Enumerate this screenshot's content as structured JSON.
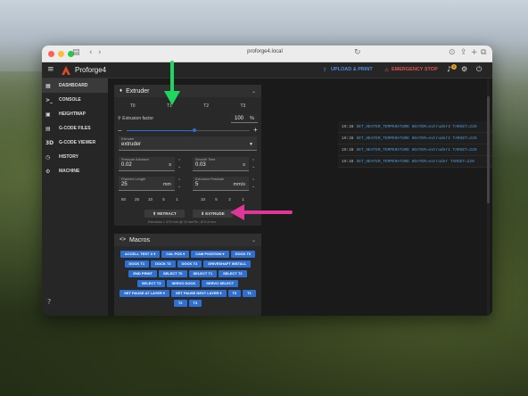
{
  "browser": {
    "url": "proforge4.local"
  },
  "app": {
    "title": "Proforge4",
    "upload_label": "UPLOAD & PRINT",
    "estop_label": "EMERGENCY STOP",
    "badge_count": "1",
    "accent": "#2f6fd0",
    "danger": "#e05050"
  },
  "sidebar": {
    "items": [
      {
        "label": "DASHBOARD",
        "icon": "dashboard-icon"
      },
      {
        "label": "CONSOLE",
        "icon": "console-icon"
      },
      {
        "label": "HEIGHTMAP",
        "icon": "heightmap-icon"
      },
      {
        "label": "G-CODE FILES",
        "icon": "files-icon"
      },
      {
        "label": "G-CODE VIEWER",
        "icon": "3d-icon"
      },
      {
        "label": "HISTORY",
        "icon": "history-icon"
      },
      {
        "label": "MACHINE",
        "icon": "machine-icon"
      }
    ]
  },
  "extruder": {
    "title": "Extruder",
    "tabs": [
      "T0",
      "T1",
      "T2",
      "T3"
    ],
    "factor_label": "Extrusion factor",
    "factor_value": "100",
    "factor_unit": "%",
    "factor_fraction": 0.55,
    "select_label": "Extruder",
    "select_value": "extruder",
    "pa_label": "Pressure Advance",
    "pa_value": "0.02",
    "pa_unit": "s",
    "st_label": "Smooth Time",
    "st_value": "0.03",
    "st_unit": "s",
    "len_label": "Filament Length",
    "len_value": "25",
    "len_unit": "mm",
    "feed_label": "Extrusion Feedrate",
    "feed_value": "5",
    "feed_unit": "mm/s",
    "len_steps": [
      "50",
      "25",
      "10",
      "5",
      "1"
    ],
    "feed_steps": [
      "10",
      "5",
      "2",
      "1"
    ],
    "retract_label": "RETRACT",
    "extrude_label": "EXTRUDE",
    "info": "Extrusion = 479 mm @ 12 mm³/s - Ø 0.4 mm"
  },
  "macros": {
    "title": "Macros",
    "buttons": [
      {
        "label": "ACCELL TEST X",
        "dropdown": true
      },
      {
        "label": "CAL POS",
        "dropdown": true
      },
      {
        "label": "CAM POSITION",
        "dropdown": true
      },
      {
        "label": "DOCK T0"
      },
      {
        "label": "DOCK T1"
      },
      {
        "label": "DOCK T2"
      },
      {
        "label": "DOCK T3"
      },
      {
        "label": "DRIVESHAFT INSTALL"
      },
      {
        "label": "END PRINT"
      },
      {
        "label": "SELECT T0"
      },
      {
        "label": "SELECT T1"
      },
      {
        "label": "SELECT T2"
      },
      {
        "label": "SELECT T3"
      },
      {
        "label": "SERVO DOCK"
      },
      {
        "label": "SERVO SELECT"
      },
      {
        "label": "SET PAUSE AT LAYER",
        "dropdown": true
      },
      {
        "label": "SET PAUSE NEXT LAYER",
        "dropdown": true
      },
      {
        "label": "T0"
      },
      {
        "label": "T1"
      },
      {
        "label": "T2"
      },
      {
        "label": "T3"
      }
    ]
  },
  "console": {
    "lines": [
      {
        "time": "19:28",
        "text": "SET_HEATER_TEMPERATURE HEATER=extruder3 TARGET=220"
      },
      {
        "time": "19:28",
        "text": "SET_HEATER_TEMPERATURE HEATER=extruder2 TARGET=220"
      },
      {
        "time": "19:28",
        "text": "SET_HEATER_TEMPERATURE HEATER=extruder1 TARGET=220"
      },
      {
        "time": "19:28",
        "text": "SET_HEATER_TEMPERATURE HEATER=extruder TARGET=220"
      }
    ]
  }
}
